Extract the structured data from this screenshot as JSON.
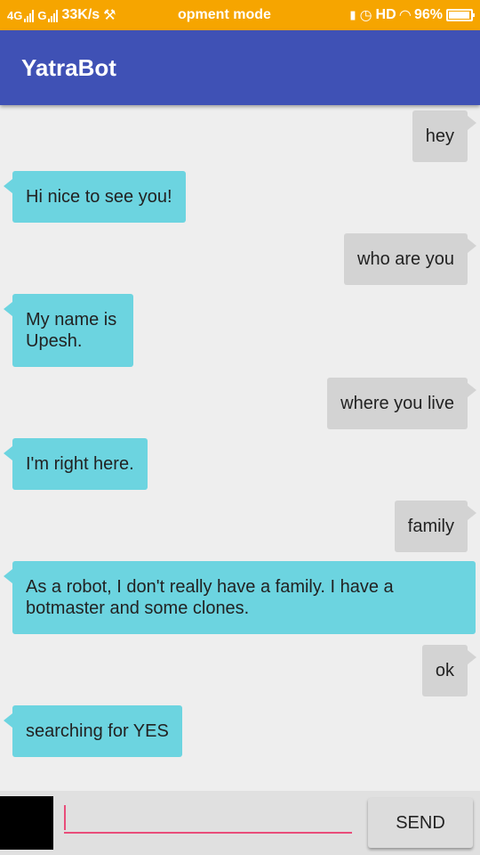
{
  "status_bar": {
    "network1": "4G",
    "network2": "G",
    "speed": "33K/s",
    "notification": "opment mode",
    "hd": "HD",
    "battery": "96%"
  },
  "app": {
    "title": "YatraBot"
  },
  "messages": [
    {
      "sender": "user",
      "text": "hey"
    },
    {
      "sender": "bot",
      "text": "Hi nice to see you!"
    },
    {
      "sender": "user",
      "text": "who are you"
    },
    {
      "sender": "bot",
      "text": "My name is Upesh."
    },
    {
      "sender": "user",
      "text": "where you live"
    },
    {
      "sender": "bot",
      "text": "I'm right here."
    },
    {
      "sender": "user",
      "text": "family"
    },
    {
      "sender": "bot",
      "text": "As a robot, I don't really have a family. I have a botmaster and some clones."
    },
    {
      "sender": "user",
      "text": "ok"
    },
    {
      "sender": "bot",
      "text": "searching for YES"
    }
  ],
  "composer": {
    "value": "",
    "send_label": "SEND"
  },
  "colors": {
    "status_bar": "#f6a500",
    "app_bar": "#3f51b5",
    "user_bubble": "#d3d3d3",
    "bot_bubble": "#6cd4e0",
    "input_accent": "#e94d7a"
  }
}
